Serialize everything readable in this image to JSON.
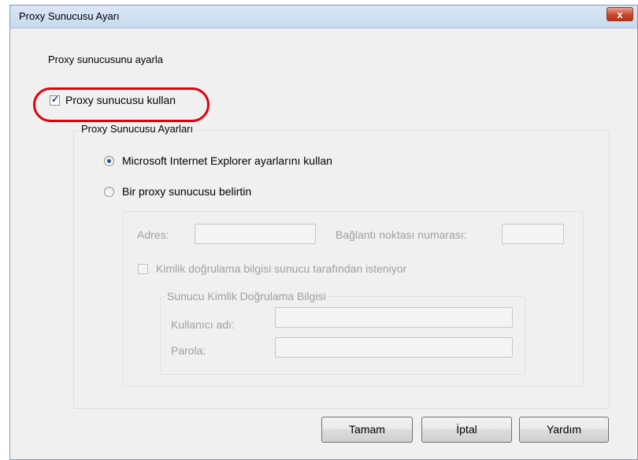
{
  "window": {
    "title": "Proxy Sunucusu Ayarı",
    "close_label": "x"
  },
  "section_label": "Proxy sunucusunu ayarla",
  "use_proxy": {
    "label": "Proxy sunucusu kullan",
    "checked": true
  },
  "proxy_settings_group": {
    "legend": "Proxy Sunucusu Ayarları",
    "ie_option": {
      "label": "Microsoft Internet Explorer ayarlarını kullan",
      "selected": true
    },
    "manual_option": {
      "label": "Bir proxy sunucusu belirtin",
      "selected": false
    },
    "address_label": "Adres:",
    "address_value": "",
    "port_label": "Bağlantı noktası numarası:",
    "port_value": "",
    "auth_required": {
      "label": "Kimlik doğrulama bilgisi sunucu tarafından isteniyor",
      "checked": false
    },
    "auth_group": {
      "legend": "Sunucu Kimlik Doğrulama Bilgisi",
      "username_label": "Kullanıcı adı:",
      "username_value": "",
      "password_label": "Parola:",
      "password_value": ""
    }
  },
  "buttons": {
    "ok": "Tamam",
    "cancel": "İptal",
    "help": "Yardım"
  },
  "colors": {
    "highlight": "#e3000b",
    "titlebar": "#c7daf0",
    "close_button": "#c9462c"
  }
}
